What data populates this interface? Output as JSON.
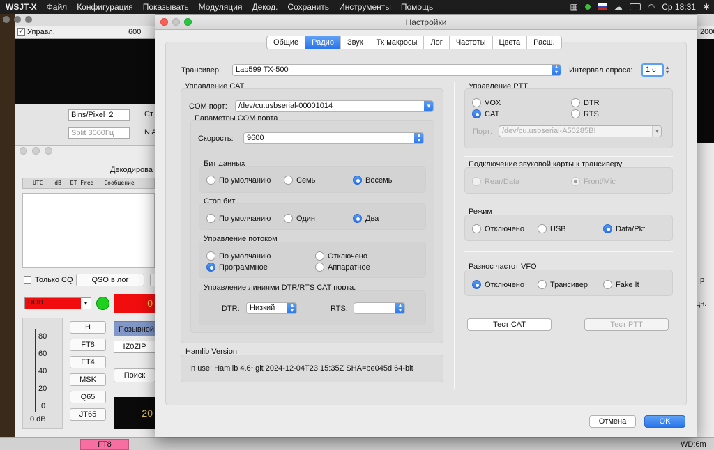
{
  "menubar": {
    "app_name": "WSJT-X",
    "items": [
      "Файл",
      "Конфигурация",
      "Показывать",
      "Модуляция",
      "Декод.",
      "Сохранить",
      "Инструменты",
      "Помощь"
    ],
    "clock": "Ср 18:31"
  },
  "background": {
    "wide_graph": {
      "checkbox_label": "Управл.",
      "freq_tick": "600",
      "freq_tick_right": "2000",
      "bins_label": "Bins/Pixel",
      "bins_value": "2",
      "split_placeholder": "Split 3000Гц",
      "st_label": "Ст",
      "na_label": "N A"
    },
    "main": {
      "decoded_title": "Декодирова",
      "columns": [
        "UTC",
        "dB",
        "DT",
        "Freq",
        "Сообщение"
      ],
      "only_cq_label": "Только CQ",
      "qso_log_label": "QSO в лог",
      "band_value": "DOB",
      "red_field_text": "0",
      "mode_buttons": [
        "H",
        "FT8",
        "FT4",
        "MSK",
        "Q65",
        "JT65"
      ],
      "callsign_label": "Позывной",
      "callsign_value": "IZ0ZIP",
      "search_label": "Поиск",
      "meter_ticks": [
        "80",
        "60",
        "40",
        "20",
        "0"
      ],
      "meter_value": "0 dB",
      "clock_fragment": "20",
      "right_fragment_1": "р",
      "right_fragment_2": "цн."
    },
    "statusbar": {
      "mode": "FT8",
      "wd": "WD:6m"
    }
  },
  "dialog": {
    "title": "Настройки",
    "tabs": [
      "Общие",
      "Радио",
      "Звук",
      "Тх макросы",
      "Лог",
      "Частоты",
      "Цвета",
      "Расш."
    ],
    "active_tab": "Радио",
    "transceiver_label": "Трансивер:",
    "transceiver_value": "Lab599 TX-500",
    "poll_label": "Интервал опроса:",
    "poll_value": "1 с",
    "cat": {
      "title": "Управление CAT",
      "com_port_label": "COM порт:",
      "com_port_value": "/dev/cu.usbserial-00001014",
      "com_params_title": "Параметры COM порта",
      "speed_label": "Скорость:",
      "speed_value": "9600",
      "data_bits": {
        "title": "Бит данных",
        "options": [
          "По умолчанию",
          "Семь",
          "Восемь"
        ],
        "selected": "Восемь"
      },
      "stop_bits": {
        "title": "Стоп бит",
        "options": [
          "По умолчанию",
          "Один",
          "Два"
        ],
        "selected": "Два"
      },
      "flow_control": {
        "title": "Управление потоком",
        "options": [
          "По умолчанию",
          "Отключено",
          "Программное",
          "Аппаратное"
        ],
        "selected": "Программное"
      },
      "dtr_rts": {
        "title": "Управление линиями DTR/RTS CAT порта.",
        "dtr_label": "DTR:",
        "dtr_value": "Низкий",
        "rts_label": "RTS:",
        "rts_value": ""
      }
    },
    "hamlib": {
      "title": "Hamlib Version",
      "text": "In use:  Hamlib 4.6~git 2024-12-04T23:15:35Z SHA=be045d 64-bit"
    },
    "ptt": {
      "title": "Управление PTT",
      "options": [
        "VOX",
        "DTR",
        "CAT",
        "RTS"
      ],
      "selected": "CAT",
      "port_label": "Порт:",
      "port_value": "/dev/cu.usbserial-A50285BI"
    },
    "audio": {
      "title": "Подключение звуковой карты к трансиверу",
      "options": [
        "Rear/Data",
        "Front/Mic"
      ],
      "selected": "Front/Mic"
    },
    "mode": {
      "title": "Режим",
      "options": [
        "Отключено",
        "USB",
        "Data/Pkt"
      ],
      "selected": "Data/Pkt"
    },
    "split": {
      "title": "Разнос частот VFO",
      "options": [
        "Отключено",
        "Трансивер",
        "Fake It"
      ],
      "selected": "Отключено"
    },
    "test_cat_label": "Тест CAT",
    "test_ptt_label": "Тест PTT",
    "cancel_label": "Отмена",
    "ok_label": "OK"
  }
}
